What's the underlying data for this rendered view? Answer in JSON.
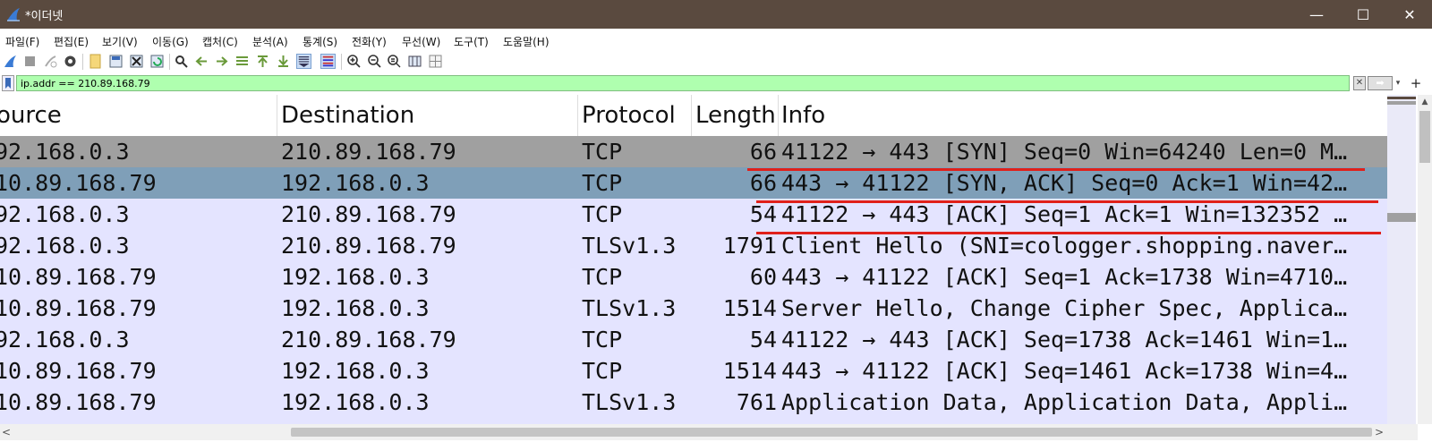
{
  "window": {
    "title": "*이더넷",
    "minimize_icon": "—",
    "maximize_icon": "☐",
    "close_icon": "✕"
  },
  "menu": [
    "파일(F)",
    "편집(E)",
    "보기(V)",
    "이동(G)",
    "캡처(C)",
    "분석(A)",
    "통계(S)",
    "전화(Y)",
    "무선(W)",
    "도구(T)",
    "도움말(H)"
  ],
  "toolbar_icons": [
    "start-capture-icon",
    "stop-capture-icon",
    "restart-capture-icon",
    "capture-options-icon",
    "open-file-icon",
    "save-file-icon",
    "close-file-icon",
    "reload-file-icon",
    "find-packet-icon",
    "go-back-icon",
    "go-forward-icon",
    "go-to-packet-icon",
    "first-packet-icon",
    "last-packet-icon",
    "autoscroll-icon",
    "colorize-icon",
    "zoom-in-icon",
    "zoom-out-icon",
    "normal-size-icon",
    "resize-columns-icon",
    "layout-icon"
  ],
  "filter": {
    "value": "ip.addr == 210.89.168.79",
    "clear_icon": "✕",
    "apply_icon": "➡",
    "dropdown_icon": "▾",
    "add_icon": "+"
  },
  "columns": {
    "source": "ource",
    "destination": "Destination",
    "protocol": "Protocol",
    "length": "Length",
    "info": "Info"
  },
  "packets": [
    {
      "src": "92.168.0.3",
      "dst": "210.89.168.79",
      "proto": "TCP",
      "len": "66",
      "info": "41122 → 443 [SYN] Seq=0 Win=64240 Len=0 M…"
    },
    {
      "src": "10.89.168.79",
      "dst": "192.168.0.3",
      "proto": "TCP",
      "len": "66",
      "info": "443 → 41122 [SYN, ACK] Seq=0 Ack=1 Win=42…"
    },
    {
      "src": "92.168.0.3",
      "dst": "210.89.168.79",
      "proto": "TCP",
      "len": "54",
      "info": "41122 → 443 [ACK] Seq=1 Ack=1 Win=132352 …"
    },
    {
      "src": "92.168.0.3",
      "dst": "210.89.168.79",
      "proto": "TLSv1.3",
      "len": "1791",
      "info": "Client Hello (SNI=cologger.shopping.naver…"
    },
    {
      "src": "10.89.168.79",
      "dst": "192.168.0.3",
      "proto": "TCP",
      "len": "60",
      "info": "443 → 41122 [ACK] Seq=1 Ack=1738 Win=4710…"
    },
    {
      "src": "10.89.168.79",
      "dst": "192.168.0.3",
      "proto": "TLSv1.3",
      "len": "1514",
      "info": "Server Hello, Change Cipher Spec, Applica…"
    },
    {
      "src": "92.168.0.3",
      "dst": "210.89.168.79",
      "proto": "TCP",
      "len": "54",
      "info": "41122 → 443 [ACK] Seq=1738 Ack=1461 Win=1…"
    },
    {
      "src": "10.89.168.79",
      "dst": "192.168.0.3",
      "proto": "TCP",
      "len": "1514",
      "info": "443 → 41122 [ACK] Seq=1461 Ack=1738 Win=4…"
    },
    {
      "src": "10.89.168.79",
      "dst": "192.168.0.3",
      "proto": "TLSv1.3",
      "len": "761",
      "info": "Application Data, Application Data, Appli…"
    }
  ],
  "scroll": {
    "up_icon": "▲",
    "left_icon": "<",
    "right_icon": ">"
  },
  "colors": {
    "title_bar": "#5a4a3f",
    "filter_bg": "#afffaf",
    "row_bg": "#e4e4ff",
    "row_selected": "#a0a0a0",
    "row_selected2": "#7f9fb8",
    "annotation": "#e0201a"
  }
}
